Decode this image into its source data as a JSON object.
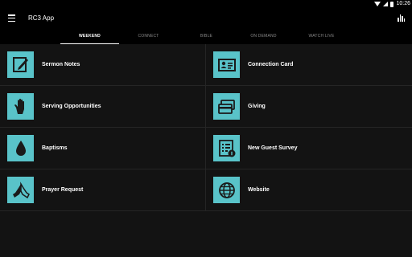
{
  "status_bar": {
    "time": "10:26"
  },
  "app_bar": {
    "title": "RC3 App"
  },
  "tabs": [
    {
      "label": "WEEKEND"
    },
    {
      "label": "CONNECT"
    },
    {
      "label": "BIBLE"
    },
    {
      "label": "ON DEMAND"
    },
    {
      "label": "WATCH LIVE"
    }
  ],
  "tiles": {
    "sermon_notes": "Sermon Notes",
    "connection_card": "Connection Card",
    "serving_opportunities": "Serving Opportunities",
    "giving": "Giving",
    "baptisms": "Baptisms",
    "new_guest_survey": "New Guest Survey",
    "prayer_request": "Prayer Request",
    "website": "Website"
  },
  "colors": {
    "accent": "#59c3c9",
    "background": "#131313",
    "bar": "#000000"
  }
}
